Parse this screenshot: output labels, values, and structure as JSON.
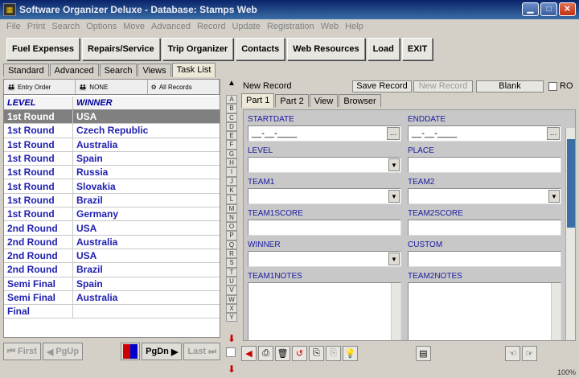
{
  "window": {
    "title": "Software Organizer Deluxe - Database: Stamps Web"
  },
  "menu": [
    "File",
    "Print",
    "Search",
    "Options",
    "Move",
    "Advanced",
    "Record",
    "Update",
    "Registration",
    "Web",
    "Help"
  ],
  "toolbar": [
    "Fuel Expenses",
    "Repairs/Service",
    "Trip Organizer",
    "Contacts",
    "Web Resources",
    "Load",
    "EXIT"
  ],
  "left_tabs": [
    "Standard",
    "Advanced",
    "Search",
    "Views",
    "Task List"
  ],
  "sort_header": [
    "Entry Order",
    "NONE",
    "All Records"
  ],
  "columns": [
    "LEVEL",
    "WINNER"
  ],
  "rows": [
    {
      "level": "1st Round",
      "winner": "USA"
    },
    {
      "level": "1st Round",
      "winner": "Czech Republic"
    },
    {
      "level": "1st Round",
      "winner": "Australia"
    },
    {
      "level": "1st Round",
      "winner": "Spain"
    },
    {
      "level": "1st Round",
      "winner": "Russia"
    },
    {
      "level": "1st Round",
      "winner": "Slovakia"
    },
    {
      "level": "1st Round",
      "winner": "Brazil"
    },
    {
      "level": "1st Round",
      "winner": "Germany"
    },
    {
      "level": "2nd Round",
      "winner": "USA"
    },
    {
      "level": "2nd Round",
      "winner": "Australia"
    },
    {
      "level": "2nd Round",
      "winner": "USA"
    },
    {
      "level": "2nd Round",
      "winner": "Brazil"
    },
    {
      "level": "Semi Final",
      "winner": "Spain"
    },
    {
      "level": "Semi Final",
      "winner": "Australia"
    },
    {
      "level": "Final",
      "winner": ""
    }
  ],
  "nav": {
    "first": "First",
    "pgup": "PgUp",
    "pgdn": "PgDn",
    "last": "Last"
  },
  "alphabet": [
    "A",
    "B",
    "C",
    "D",
    "E",
    "F",
    "G",
    "H",
    "I",
    "J",
    "K",
    "L",
    "M",
    "N",
    "O",
    "P",
    "Q",
    "R",
    "S",
    "T",
    "U",
    "V",
    "W",
    "X",
    "Y"
  ],
  "record": {
    "status": "New Record",
    "save": "Save Record",
    "new": "New Record",
    "blank": "Blank",
    "ro": "RO"
  },
  "record_tabs": [
    "Part 1",
    "Part 2",
    "View",
    "Browser"
  ],
  "fields": {
    "startdate": "STARTDATE",
    "startdate_value": "__-__-____",
    "enddate": "ENDDATE",
    "enddate_value": "__-__-____",
    "level": "LEVEL",
    "place": "PLACE",
    "team1": "TEAM1",
    "team2": "TEAM2",
    "team1score": "TEAM1SCORE",
    "team2score": "TEAM2SCORE",
    "winner": "WINNER",
    "custom": "CUSTOM",
    "team1notes": "TEAM1NOTES",
    "team2notes": "TEAM2NOTES"
  },
  "zoom": "100%"
}
